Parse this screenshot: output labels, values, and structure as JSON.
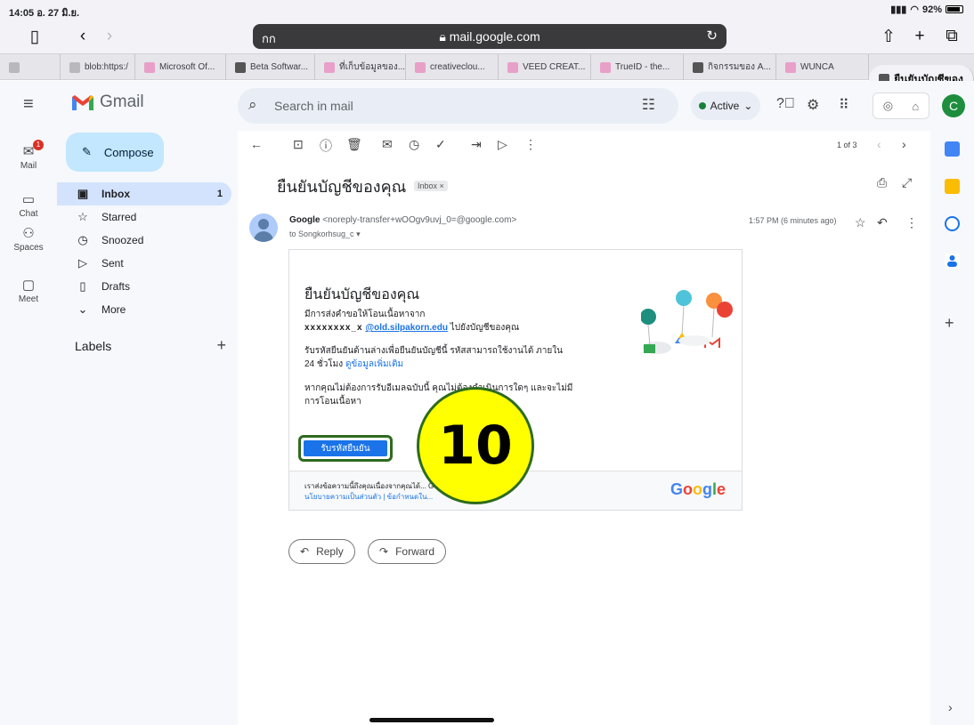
{
  "status": {
    "time": "14:05",
    "date": "อ. 27 มิ.ย.",
    "battery": "92%"
  },
  "browser": {
    "text_size": "กก",
    "url": "mail.google.com"
  },
  "tabs": [
    {
      "label": ""
    },
    {
      "label": "blob:https:/"
    },
    {
      "label": "Microsoft Of..."
    },
    {
      "label": "Beta Softwar..."
    },
    {
      "label": "ที่เก็บข้อมูลของ..."
    },
    {
      "label": "creativeclou..."
    },
    {
      "label": "VEED CREAT..."
    },
    {
      "label": "TrueID - the..."
    },
    {
      "label": "กิจกรรมของ A..."
    },
    {
      "label": "WUNCA"
    },
    {
      "label": "ยืนยันบัญชีของ..."
    }
  ],
  "gmail": {
    "logo_text": "Gmail",
    "search_placeholder": "Search in mail",
    "status": "Active",
    "avatar_letter": "C"
  },
  "rail": {
    "mail": "Mail",
    "mail_badge": "1",
    "chat": "Chat",
    "spaces": "Spaces",
    "meet": "Meet"
  },
  "nav": {
    "compose": "Compose",
    "items": [
      {
        "label": "Inbox",
        "count": "1"
      },
      {
        "label": "Starred"
      },
      {
        "label": "Snoozed"
      },
      {
        "label": "Sent"
      },
      {
        "label": "Drafts"
      },
      {
        "label": "More"
      }
    ],
    "labels_title": "Labels"
  },
  "message": {
    "pager": "1 of 3",
    "subject": "ยืนยันบัญชีของคุณ",
    "chip": "Inbox ×",
    "sender_name": "Google",
    "sender_addr": "<noreply-transfer+wOOgv9uvj_0=@google.com>",
    "to": "to Songkorhsug_c",
    "time": "1:57 PM (6 minutes ago)",
    "card": {
      "heading": "ยืนยันบัญชีของคุณ",
      "p1_line1": "มีการส่งคำขอให้โอนเนื้อหาจาก",
      "p1_mask": "xxxxxxxx_x",
      "p1_link": "@old.silpakorn.edu",
      "p1_tail": "ไปยังบัญชีของคุณ",
      "p2": "รับรหัสยืนยันด้านล่างเพื่อยืนยันบัญชีนี้ รหัสสามารถใช้งานได้ ภายใน 24 ชั่วโมง",
      "p2_link": "ดูข้อมูลเพิ่มเติม",
      "p3": "หากคุณไม่ต้องการรับอีเมลฉบับนี้ คุณไม่ต้องดำเนินการใดๆ และจะไม่มีการโอนเนื้อหา",
      "button": "รับรหัสยืนยัน",
      "footer1": "เราส่งข้อความนี้ถึงคุณเนื่องจากคุณได้... Google",
      "footer2": "นโยบายความเป็นส่วนตัว | ข้อกำหนดใน...",
      "footer_logo": "Google"
    },
    "reply": "Reply",
    "forward": "Forward"
  },
  "annotation": {
    "step": "10"
  },
  "colors": {
    "accent": "#1a73e8",
    "highlight": "#ffff00",
    "outline": "#2e6b1e",
    "inbox_sel": "#d3e3fd",
    "compose": "#c2e7ff"
  }
}
